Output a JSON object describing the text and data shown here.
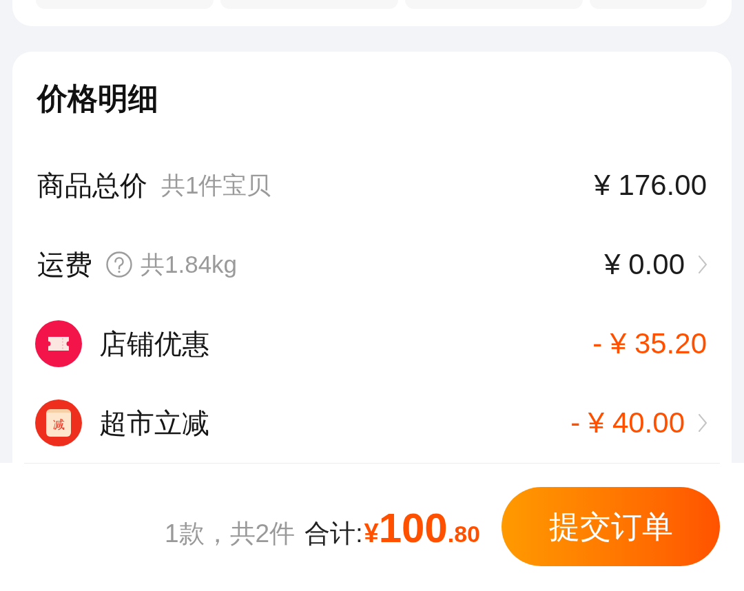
{
  "price_detail": {
    "title": "价格明细",
    "rows": [
      {
        "kind": "plain",
        "label": "商品总价",
        "note": "共1件宝贝",
        "amount": "¥ 176.00",
        "discount": false,
        "has_chevron": false
      },
      {
        "kind": "help",
        "label": "运费",
        "note": "共1.84kg",
        "amount": "¥ 0.00",
        "discount": false,
        "has_chevron": true
      },
      {
        "kind": "coupon",
        "label": "店铺优惠",
        "amount": "- ¥ 35.20",
        "discount": true,
        "has_chevron": false
      },
      {
        "kind": "reduction",
        "label": "超市立减",
        "icon_text": "减",
        "amount": "- ¥ 40.00",
        "discount": true,
        "has_chevron": true
      }
    ]
  },
  "footer": {
    "count": "1款，共2件",
    "total_label": "合计:",
    "currency": "¥",
    "total_integer": "100",
    "total_decimal": ".80",
    "submit": "提交订单"
  }
}
